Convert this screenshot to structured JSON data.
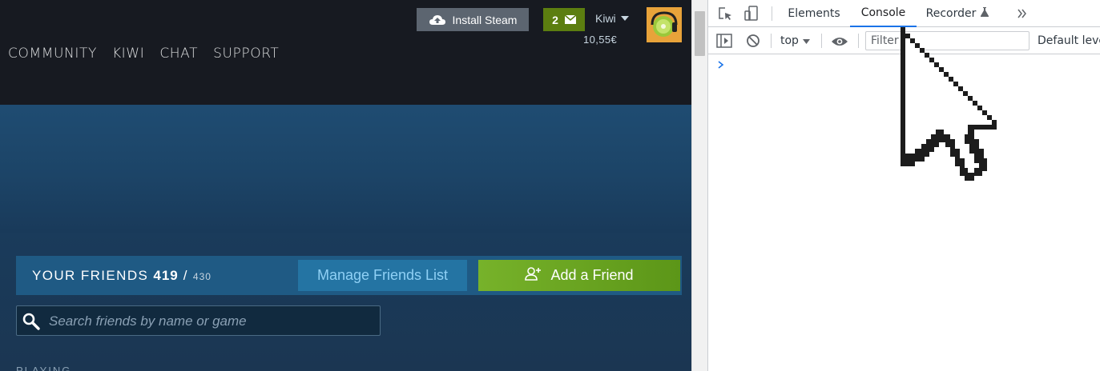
{
  "steam": {
    "nav": [
      "COMMUNITY",
      "KIWI",
      "CHAT",
      "SUPPORT"
    ],
    "install_label": "Install Steam",
    "notification_count": "2",
    "user_name": "Kiwi",
    "wallet": "10,55€",
    "friends": {
      "title": "YOUR FRIENDS",
      "count": "419",
      "separator": "/",
      "limit": "430",
      "manage_label": "Manage Friends List",
      "add_label": "Add a Friend"
    },
    "search": {
      "placeholder": "Search friends by name or game"
    },
    "section_label": "PLAYING"
  },
  "devtools": {
    "tabs": [
      "Elements",
      "Console",
      "Recorder"
    ],
    "active_tab": "Console",
    "context": "top",
    "filter_placeholder": "Filter",
    "levels_label": "Default levels"
  },
  "colors": {
    "steam_header": "#171a21",
    "steam_blue": "#1b3a55",
    "add_green": "#6ca51f",
    "devtools_accent": "#1a73e8"
  },
  "icons": [
    "upload-cloud-icon",
    "envelope-icon",
    "user-plus-icon",
    "search-icon",
    "inspect-icon",
    "device-toggle-icon",
    "sidebar-icon",
    "clear-console-icon",
    "eye-icon",
    "flask-icon",
    "chevron-more-icon"
  ]
}
